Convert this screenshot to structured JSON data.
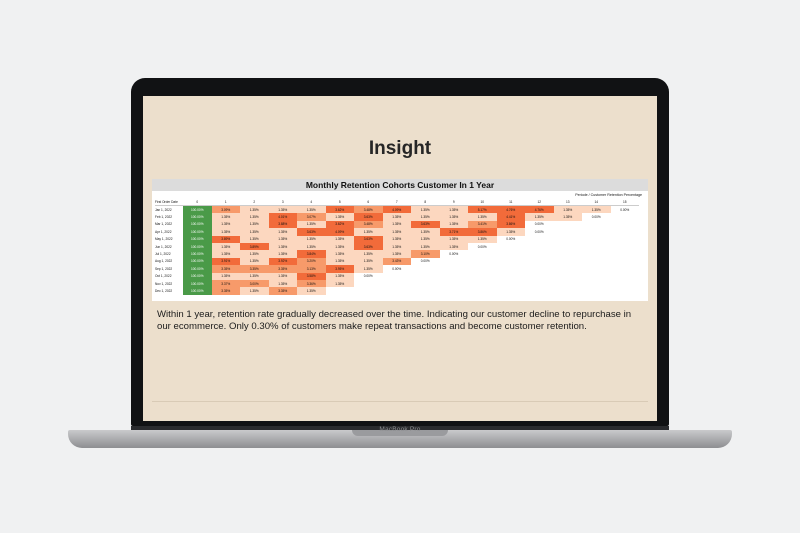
{
  "slide": {
    "title": "Insight",
    "chart_title": "Monthly Retention Cohorts Customer In 1 Year",
    "pivot_label": "Periode / Customer Retention Percentage",
    "column_headers": [
      "First Order Date",
      "0",
      "1",
      "2",
      "3",
      "4",
      "5",
      "6",
      "7",
      "8",
      "9",
      "10",
      "11",
      "12",
      "13",
      "14",
      "15"
    ],
    "rows": [
      {
        "label": "Jan 1, 2022",
        "values": [
          "100.00%",
          "3.09%",
          "1.35%",
          "1.35%",
          "1.35%",
          "3.62%",
          "3.48%",
          "4.09%",
          "1.35%",
          "1.35%",
          "5.17%",
          "4.76%",
          "4.76%",
          "1.35%",
          "1.35%",
          "0.00%"
        ]
      },
      {
        "label": "Feb 1, 2022",
        "values": [
          "100.00%",
          "1.35%",
          "1.35%",
          "4.01%",
          "3.07%",
          "1.35%",
          "3.63%",
          "1.35%",
          "1.35%",
          "1.35%",
          "1.35%",
          "4.41%",
          "1.35%",
          "1.35%",
          "0.00%",
          ""
        ]
      },
      {
        "label": "Mar 1, 2022",
        "values": [
          "100.00%",
          "1.35%",
          "1.35%",
          "3.88%",
          "1.35%",
          "3.62%",
          "3.48%",
          "1.35%",
          "3.63%",
          "1.35%",
          "3.41%",
          "3.86%",
          "0.00%",
          "",
          "",
          ""
        ]
      },
      {
        "label": "Apr 1, 2022",
        "values": [
          "100.00%",
          "1.35%",
          "1.35%",
          "1.35%",
          "3.63%",
          "4.09%",
          "1.35%",
          "1.35%",
          "1.35%",
          "3.71%",
          "3.86%",
          "1.35%",
          "0.00%",
          "",
          "",
          ""
        ]
      },
      {
        "label": "May 1, 2022",
        "values": [
          "100.00%",
          "3.89%",
          "1.35%",
          "1.35%",
          "1.35%",
          "1.35%",
          "3.63%",
          "1.35%",
          "1.35%",
          "1.35%",
          "1.35%",
          "0.00%",
          "",
          "",
          "",
          ""
        ]
      },
      {
        "label": "Jun 1, 2022",
        "values": [
          "100.00%",
          "1.35%",
          "3.89%",
          "1.35%",
          "1.35%",
          "1.35%",
          "3.63%",
          "1.35%",
          "1.35%",
          "1.35%",
          "0.00%",
          "",
          "",
          "",
          "",
          ""
        ]
      },
      {
        "label": "Jul 1, 2022",
        "values": [
          "100.00%",
          "1.35%",
          "1.35%",
          "1.35%",
          "3.84%",
          "1.35%",
          "1.35%",
          "1.35%",
          "3.10%",
          "0.00%",
          "",
          "",
          "",
          "",
          "",
          ""
        ]
      },
      {
        "label": "Aug 1, 2022",
        "values": [
          "100.00%",
          "3.91%",
          "1.35%",
          "3.92%",
          "3.20%",
          "1.35%",
          "1.35%",
          "3.43%",
          "0.00%",
          "",
          "",
          "",
          "",
          "",
          "",
          ""
        ]
      },
      {
        "label": "Sep 1, 2022",
        "values": [
          "100.00%",
          "3.35%",
          "3.35%",
          "3.35%",
          "3.13%",
          "3.95%",
          "1.35%",
          "0.00%",
          "",
          "",
          "",
          "",
          "",
          "",
          "",
          ""
        ]
      },
      {
        "label": "Oct 1, 2022",
        "values": [
          "100.00%",
          "1.35%",
          "1.35%",
          "1.35%",
          "3.58%",
          "1.35%",
          "0.00%",
          "",
          "",
          "",
          "",
          "",
          "",
          "",
          "",
          ""
        ]
      },
      {
        "label": "Nov 1, 2022",
        "values": [
          "100.00%",
          "3.37%",
          "3.00%",
          "1.35%",
          "3.36%",
          "1.35%",
          "",
          "",
          "",
          "",
          "",
          "",
          "",
          "",
          "",
          ""
        ]
      },
      {
        "label": "Dec 1, 2022",
        "values": [
          "100.00%",
          "3.35%",
          "1.35%",
          "3.35%",
          "1.35%",
          "",
          "",
          "",
          "",
          "",
          "",
          "",
          "",
          "",
          "",
          ""
        ]
      }
    ],
    "insight_text": "Within 1 year, retention rate gradually decreased over the time. Indicating our customer decline to repurchase in our ecommerce. Only 0.30% of customers make repeat transactions and become customer retention."
  },
  "device": {
    "label": "MacBook Pro"
  },
  "colors": {
    "slide_bg": "#ecdfcc",
    "cohort_green": "#4a9a48",
    "heat_dark": "#f26b3a",
    "heat_mid": "#f79a6a",
    "heat_light": "#fcd7bf"
  }
}
